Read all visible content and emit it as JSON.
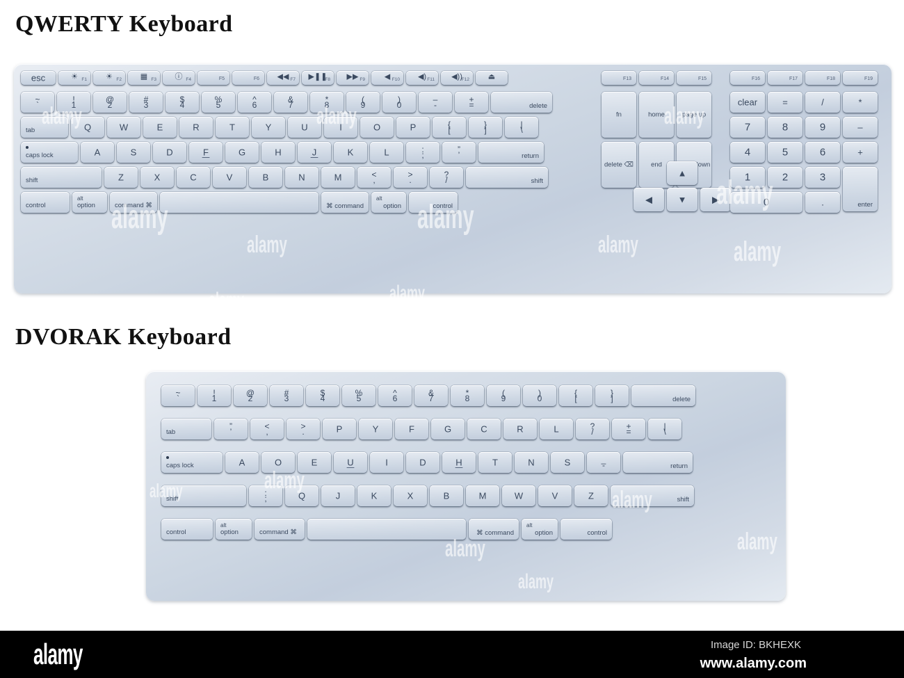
{
  "page": {
    "background": "#ffffff",
    "accent": "#3b4a60",
    "key_face": "#d7dfe9",
    "chassis": "#ccd6e2"
  },
  "sections": [
    {
      "id": "qwerty",
      "title": "QWERTY Keyboard"
    },
    {
      "id": "dvorak",
      "title": "DVORAK Keyboard"
    }
  ],
  "watermark": {
    "text": "alamy"
  },
  "footer": {
    "logo": "alamy",
    "image_id": "Image ID: BKHEXK",
    "url": "www.alamy.com"
  },
  "qwerty": {
    "function_row": [
      {
        "name": "esc",
        "label": "esc"
      },
      {
        "name": "f1",
        "icon": "brightness-down-icon",
        "glyph": "☀",
        "fnum": "F1"
      },
      {
        "name": "f2",
        "icon": "brightness-up-icon",
        "glyph": "☀",
        "fnum": "F2"
      },
      {
        "name": "f3",
        "icon": "mission-control-icon",
        "glyph": "▦",
        "fnum": "F3"
      },
      {
        "name": "f4",
        "icon": "dashboard-icon",
        "glyph": "ⓘ",
        "fnum": "F4"
      },
      {
        "name": "f5",
        "icon": "",
        "glyph": "",
        "fnum": "F5"
      },
      {
        "name": "f6",
        "icon": "",
        "glyph": "",
        "fnum": "F6"
      },
      {
        "name": "f7",
        "icon": "rewind-icon",
        "glyph": "◀◀",
        "fnum": "F7"
      },
      {
        "name": "f8",
        "icon": "play-pause-icon",
        "glyph": "▶❚❚",
        "fnum": "F8"
      },
      {
        "name": "f9",
        "icon": "fast-forward-icon",
        "glyph": "▶▶",
        "fnum": "F9"
      },
      {
        "name": "f10",
        "icon": "mute-icon",
        "glyph": "◀",
        "fnum": "F10"
      },
      {
        "name": "f11",
        "icon": "volume-down-icon",
        "glyph": "◀)",
        "fnum": "F11"
      },
      {
        "name": "f12",
        "icon": "volume-up-icon",
        "glyph": "◀))",
        "fnum": "F12"
      },
      {
        "name": "eject",
        "icon": "eject-icon",
        "glyph": "⏏",
        "fnum": ""
      }
    ],
    "number_row": [
      {
        "upper": "~",
        "lower": "`"
      },
      {
        "upper": "!",
        "lower": "1"
      },
      {
        "upper": "@",
        "lower": "2"
      },
      {
        "upper": "#",
        "lower": "3"
      },
      {
        "upper": "$",
        "lower": "4"
      },
      {
        "upper": "%",
        "lower": "5"
      },
      {
        "upper": "^",
        "lower": "6"
      },
      {
        "upper": "&",
        "lower": "7"
      },
      {
        "upper": "*",
        "lower": "8"
      },
      {
        "upper": "(",
        "lower": "9"
      },
      {
        "upper": ")",
        "lower": "0"
      },
      {
        "upper": "–",
        "lower": "-"
      },
      {
        "upper": "+",
        "lower": "="
      },
      {
        "label": "delete"
      }
    ],
    "top_row": [
      {
        "label": "tab"
      },
      {
        "label": "Q"
      },
      {
        "label": "W"
      },
      {
        "label": "E"
      },
      {
        "label": "R"
      },
      {
        "label": "T"
      },
      {
        "label": "Y"
      },
      {
        "label": "U"
      },
      {
        "label": "I"
      },
      {
        "label": "O"
      },
      {
        "label": "P"
      },
      {
        "upper": "{",
        "lower": "["
      },
      {
        "upper": "}",
        "lower": "]"
      },
      {
        "upper": "|",
        "lower": "\\"
      }
    ],
    "home_row": [
      {
        "label": "caps lock"
      },
      {
        "label": "A"
      },
      {
        "label": "S"
      },
      {
        "label": "D"
      },
      {
        "label": "F",
        "homekey": true
      },
      {
        "label": "G"
      },
      {
        "label": "H"
      },
      {
        "label": "J",
        "homekey": true
      },
      {
        "label": "K"
      },
      {
        "label": "L"
      },
      {
        "upper": ":",
        "lower": ";"
      },
      {
        "upper": "”",
        "lower": "’"
      },
      {
        "label": "return"
      }
    ],
    "bottom_row": [
      {
        "label": "shift"
      },
      {
        "label": "Z"
      },
      {
        "label": "X"
      },
      {
        "label": "C"
      },
      {
        "label": "V"
      },
      {
        "label": "B"
      },
      {
        "label": "N"
      },
      {
        "label": "M"
      },
      {
        "upper": "<",
        "lower": ","
      },
      {
        "upper": ">",
        "lower": "."
      },
      {
        "upper": "?",
        "lower": "/"
      },
      {
        "label": "shift"
      }
    ],
    "modifier_row": [
      {
        "label": "control"
      },
      {
        "label": "option",
        "alt": "alt"
      },
      {
        "label": "command ⌘"
      },
      {
        "label": ""
      },
      {
        "label": "⌘ command"
      },
      {
        "label": "option",
        "alt": "alt"
      },
      {
        "label": "control"
      }
    ],
    "nav_cluster": {
      "function_keys": [
        "F13",
        "F14",
        "F15"
      ],
      "row1": [
        "fn",
        "home",
        "page up"
      ],
      "row2": [
        "delete ⌫",
        "end",
        "page down"
      ],
      "arrows": {
        "up": "▲",
        "left": "◀",
        "down": "▼",
        "right": "▶"
      }
    },
    "numpad": {
      "function_keys": [
        "F16",
        "F17",
        "F18",
        "F19"
      ],
      "row1": [
        "clear",
        "=",
        "/",
        "*"
      ],
      "row2": [
        "7",
        "8",
        "9",
        "–"
      ],
      "row3": [
        "4",
        "5",
        "6",
        "+"
      ],
      "row4": [
        "1",
        "2",
        "3"
      ],
      "row5": [
        "0",
        "."
      ],
      "enter": "enter"
    }
  },
  "dvorak": {
    "number_row": [
      {
        "upper": "~",
        "lower": "`"
      },
      {
        "upper": "!",
        "lower": "1"
      },
      {
        "upper": "@",
        "lower": "2"
      },
      {
        "upper": "#",
        "lower": "3"
      },
      {
        "upper": "$",
        "lower": "4"
      },
      {
        "upper": "%",
        "lower": "5"
      },
      {
        "upper": "^",
        "lower": "6"
      },
      {
        "upper": "&",
        "lower": "7"
      },
      {
        "upper": "*",
        "lower": "8"
      },
      {
        "upper": "(",
        "lower": "9"
      },
      {
        "upper": ")",
        "lower": "0"
      },
      {
        "upper": "{",
        "lower": "["
      },
      {
        "upper": "}",
        "lower": "]"
      },
      {
        "label": "delete"
      }
    ],
    "top_row": [
      {
        "label": "tab"
      },
      {
        "upper": "”",
        "lower": "’"
      },
      {
        "upper": "<",
        "lower": ","
      },
      {
        "upper": ">",
        "lower": "."
      },
      {
        "label": "P"
      },
      {
        "label": "Y"
      },
      {
        "label": "F"
      },
      {
        "label": "G"
      },
      {
        "label": "C"
      },
      {
        "label": "R"
      },
      {
        "label": "L"
      },
      {
        "upper": "?",
        "lower": "/"
      },
      {
        "upper": "+",
        "lower": "="
      },
      {
        "upper": "|",
        "lower": "\\"
      }
    ],
    "home_row": [
      {
        "label": "caps lock"
      },
      {
        "label": "A"
      },
      {
        "label": "O"
      },
      {
        "label": "E"
      },
      {
        "label": "U",
        "homekey": true
      },
      {
        "label": "I"
      },
      {
        "label": "D"
      },
      {
        "label": "H",
        "homekey": true
      },
      {
        "label": "T"
      },
      {
        "label": "N"
      },
      {
        "label": "S"
      },
      {
        "upper": "_",
        "lower": "-"
      },
      {
        "label": "return"
      }
    ],
    "bottom_row": [
      {
        "label": "shift"
      },
      {
        "upper": ":",
        "lower": ";"
      },
      {
        "label": "Q"
      },
      {
        "label": "J"
      },
      {
        "label": "K"
      },
      {
        "label": "X"
      },
      {
        "label": "B"
      },
      {
        "label": "M"
      },
      {
        "label": "W"
      },
      {
        "label": "V"
      },
      {
        "label": "Z"
      },
      {
        "label": "shift"
      }
    ],
    "modifier_row": [
      {
        "label": "control"
      },
      {
        "label": "option",
        "alt": "alt"
      },
      {
        "label": "command ⌘"
      },
      {
        "label": ""
      },
      {
        "label": "⌘ command"
      },
      {
        "label": "option",
        "alt": "alt"
      },
      {
        "label": "control"
      }
    ]
  }
}
